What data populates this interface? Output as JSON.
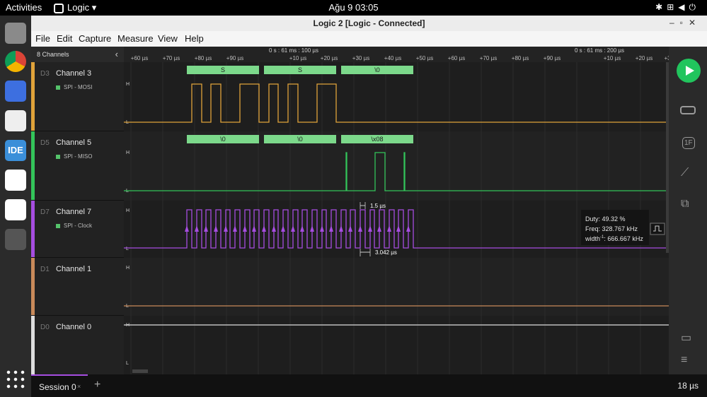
{
  "system": {
    "activities": "Activities",
    "app_name": "Logic",
    "clock": "Ağu 9  03:05"
  },
  "window": {
    "title": "Logic 2 [Logic - Connected]"
  },
  "menu": [
    "File",
    "Edit",
    "Capture",
    "Measure",
    "View",
    "Help"
  ],
  "panel": {
    "channel_count": "8 Channels"
  },
  "channels": [
    {
      "id": "D3",
      "name": "Channel 3",
      "analyzer": "SPI - MOSI",
      "color": "#e0a33a"
    },
    {
      "id": "D5",
      "name": "Channel 5",
      "analyzer": "SPI - MISO",
      "color": "#33c45a"
    },
    {
      "id": "D7",
      "name": "Channel 7",
      "analyzer": "SPI - Clock",
      "color": "#a64de0"
    },
    {
      "id": "D1",
      "name": "Channel 1",
      "analyzer": "",
      "color": "#c98a5a"
    },
    {
      "id": "D0",
      "name": "Channel 0",
      "analyzer": "",
      "color": "#dddddd"
    }
  ],
  "timeline": {
    "marker_left": "0 s : 61 ms : 100 µs",
    "marker_right": "0 s : 61 ms : 200 µs",
    "ticks": [
      "+60 µs",
      "+70 µs",
      "+80 µs",
      "+90 µs",
      "+10 µs",
      "+20 µs",
      "+30 µs",
      "+40 µs",
      "+50 µs",
      "+60 µs",
      "+70 µs",
      "+80 µs",
      "+90 µs",
      "+10 µs",
      "+20 µs",
      "+3"
    ]
  },
  "decodes": {
    "mosi": [
      "S",
      "S",
      "\\0"
    ],
    "miso": [
      "\\0",
      "\\0",
      "\\x08"
    ]
  },
  "levels": {
    "high": "H",
    "low": "L"
  },
  "measurements": {
    "pulse_width": "1.5 µs",
    "period": "3.042 µs",
    "duty": "Duty: 49.32 %",
    "freq": "Freq: 328.767 kHz",
    "inverse_width": "width",
    "inverse_width_sup": "-1",
    "inverse_width_value": ": 666.667 kHz"
  },
  "icons": {
    "play": "play-icon",
    "analyzers": "analyzers-icon",
    "extensions": "extensions-icon",
    "measure": "ruler-icon",
    "layout": "layout-icon",
    "feedback": "chat-icon",
    "menu": "hamburger-icon"
  },
  "session": {
    "tab_label": "Session 0",
    "close": "×",
    "add": "+",
    "zoom": "18 µs"
  }
}
